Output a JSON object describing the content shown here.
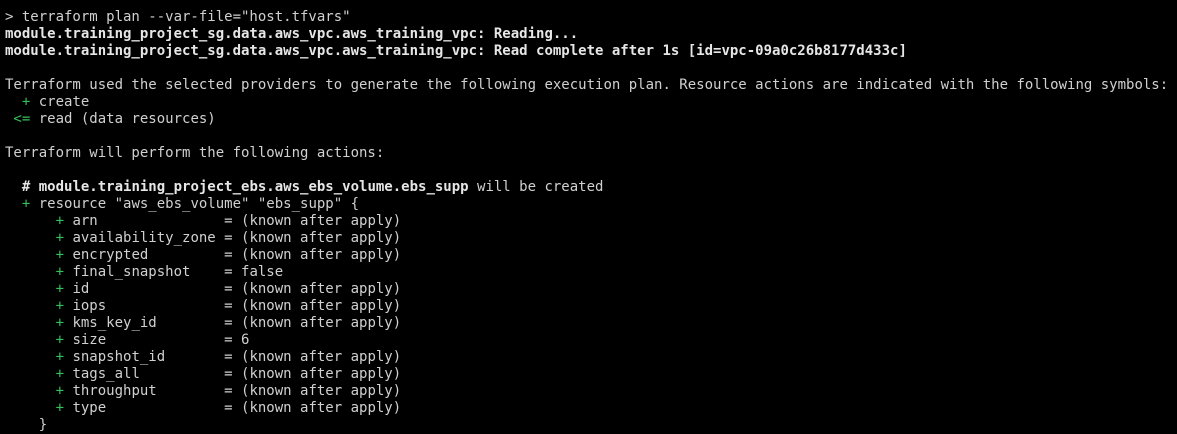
{
  "terminal": {
    "command": "> terraform plan --var-file=\"host.tfvars\"",
    "reading_line": "module.training_project_sg.data.aws_vpc.aws_training_vpc: Reading...",
    "read_complete_line": "module.training_project_sg.data.aws_vpc.aws_training_vpc: Read complete after 1s [id=vpc-09a0c26b8177d433c]",
    "providers_line": "Terraform used the selected providers to generate the following execution plan. Resource actions are indicated with the following symbols:",
    "symbols": [
      {
        "symbol": "  +",
        "text": " create"
      },
      {
        "symbol": " <=",
        "text": " read (data resources)"
      }
    ],
    "perform_line": "Terraform will perform the following actions:",
    "resource_comment_hash": "  #",
    "resource_comment_name": " module.training_project_ebs.aws_ebs_volume.ebs_supp",
    "resource_comment_tail": " will be created",
    "resource_open_symbol": "  +",
    "resource_open_text": " resource \"aws_ebs_volume\" \"ebs_supp\" {",
    "attributes": [
      {
        "symbol": "      +",
        "text": " arn               = (known after apply)"
      },
      {
        "symbol": "      +",
        "text": " availability_zone = (known after apply)"
      },
      {
        "symbol": "      +",
        "text": " encrypted         = (known after apply)"
      },
      {
        "symbol": "      +",
        "text": " final_snapshot    = false"
      },
      {
        "symbol": "      +",
        "text": " id                = (known after apply)"
      },
      {
        "symbol": "      +",
        "text": " iops              = (known after apply)"
      },
      {
        "symbol": "      +",
        "text": " kms_key_id        = (known after apply)"
      },
      {
        "symbol": "      +",
        "text": " size              = 6"
      },
      {
        "symbol": "      +",
        "text": " snapshot_id       = (known after apply)"
      },
      {
        "symbol": "      +",
        "text": " tags_all          = (known after apply)"
      },
      {
        "symbol": "      +",
        "text": " throughput        = (known after apply)"
      },
      {
        "symbol": "      +",
        "text": " type              = (known after apply)"
      }
    ],
    "closing_brace": "    }"
  },
  "colors": {
    "background": "#000000",
    "text": "#d0d0d0",
    "add_symbol": "#33c05a"
  }
}
